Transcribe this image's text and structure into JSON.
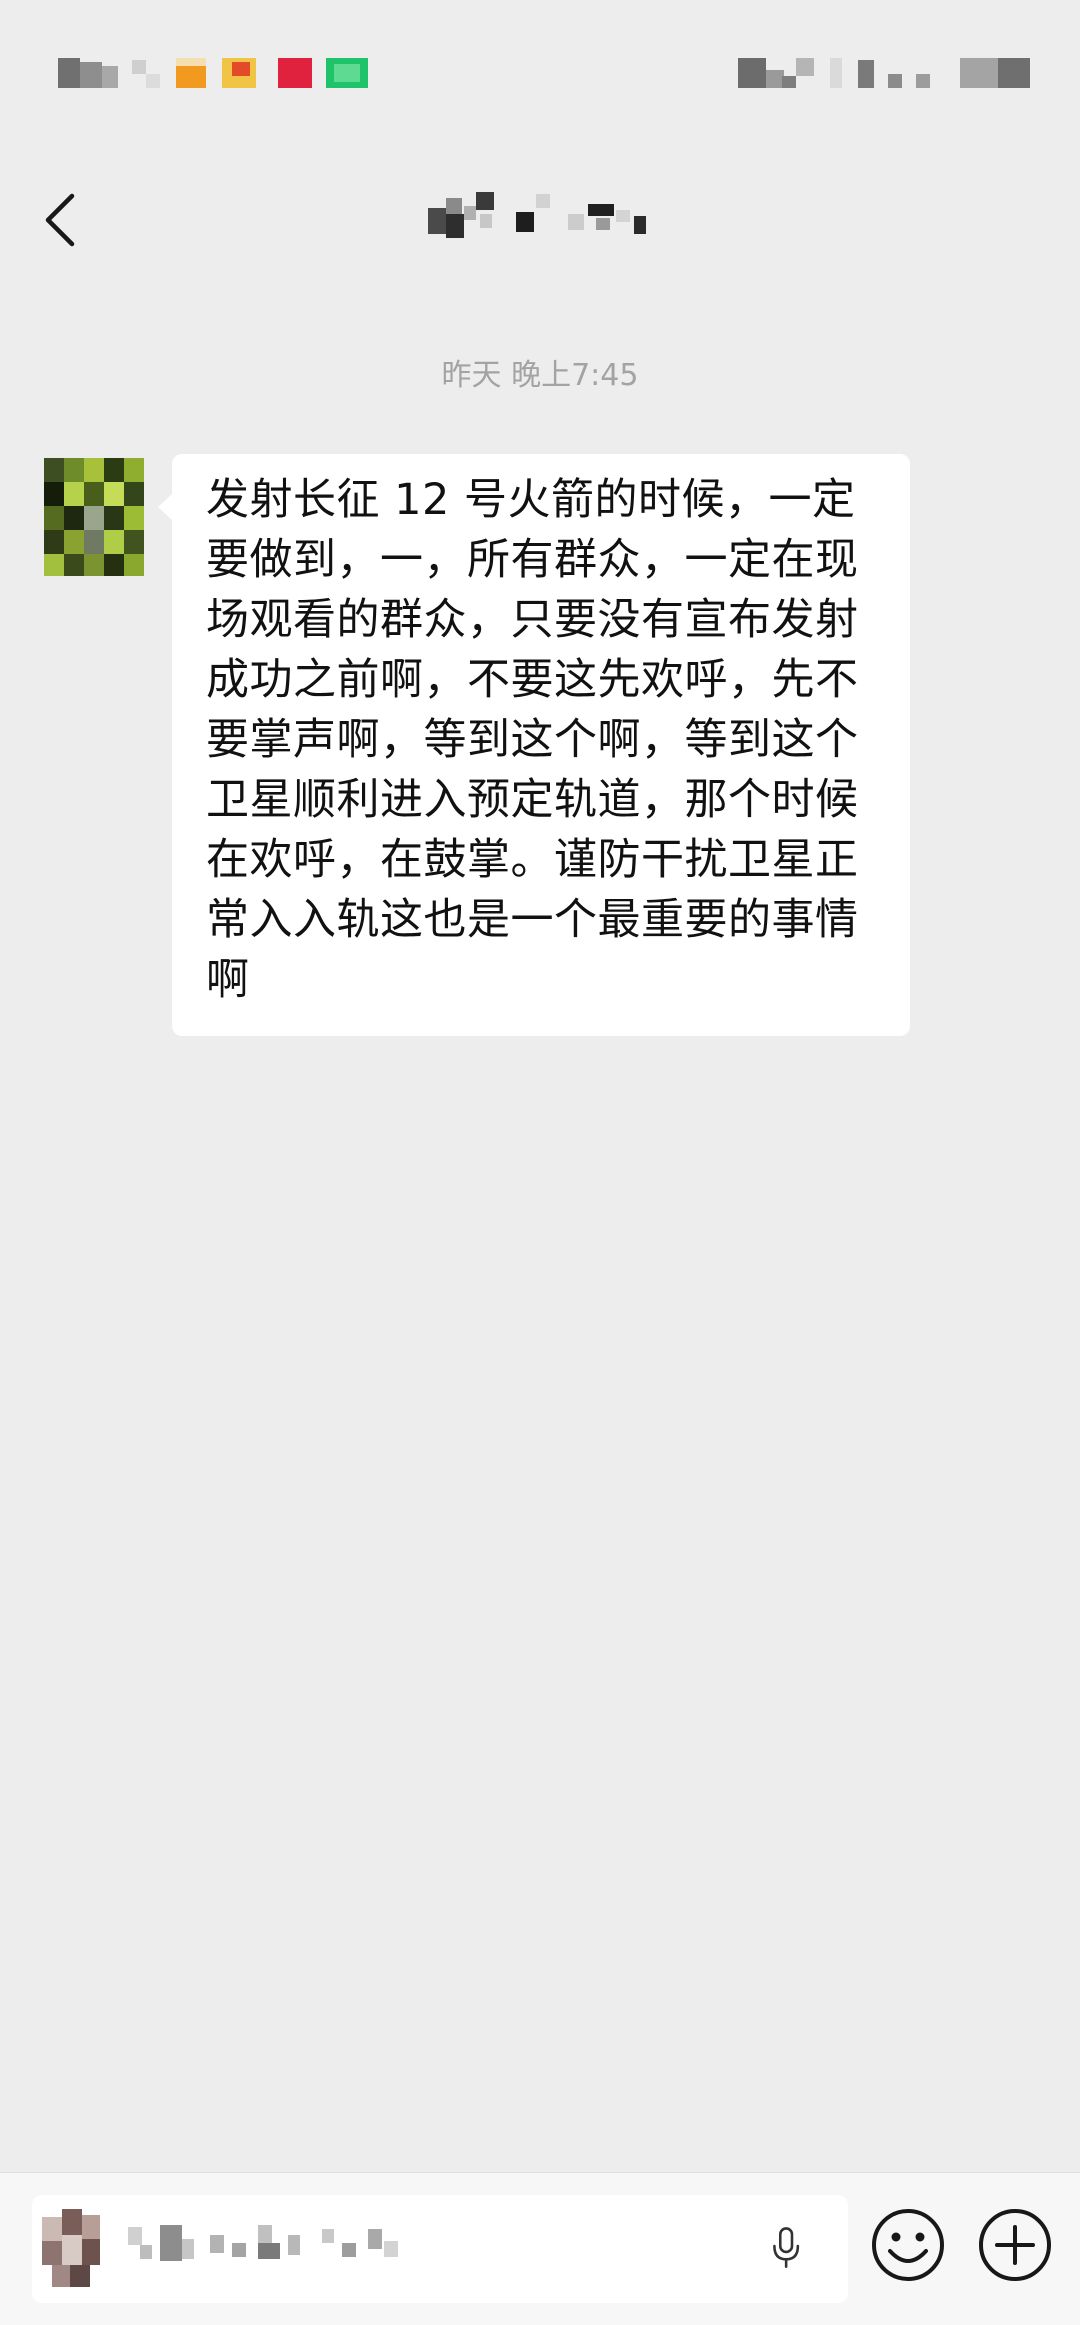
{
  "chat": {
    "timestamp": "昨天 晚上7:45",
    "messages": [
      {
        "sender": "contact",
        "text": "发射长征 12 号火箭的时候，一定要做到，一，所有群众，一定在现场观看的群众，只要没有宣布发射成功之前啊，不要这先欢呼，先不要掌声啊，等到这个啊，等到这个卫星顺利进入预定轨道，那个时候在欢呼，在鼓掌。谨防干扰卫星正常入入轨这也是一个最重要的事情啊"
      }
    ]
  },
  "icons": {
    "back": "chevron-left-icon",
    "voice": "microphone-icon",
    "emoji": "smiley-icon",
    "more": "plus-circle-icon"
  },
  "colors": {
    "background": "#ededed",
    "bubble": "#ffffff",
    "timestamp": "#a3a3a3",
    "input_bar": "#f7f7f7"
  }
}
